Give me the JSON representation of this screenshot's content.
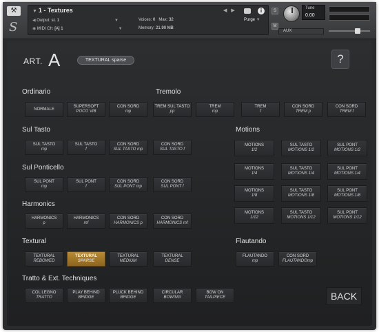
{
  "header": {
    "instrument_title": "1 - Textures",
    "output_label": "Output:",
    "output_value": "st. 1",
    "midi_label": "MIDI Ch:",
    "midi_value": "[A] 1",
    "voices_label": "Voices:",
    "voices_value": "0",
    "max_label": "Max:",
    "max_value": "32",
    "memory_label": "Memory:",
    "memory_value": "21.90 MB",
    "purge_label": "Purge",
    "tune_label": "Tune",
    "tune_value": "0.00",
    "s_button": "S",
    "m_button": "M",
    "aux_label": "AUX",
    "logo": "S"
  },
  "panel": {
    "art_label": "ART.",
    "art_letter": "A",
    "art_preset": "TEXTURAL sparse",
    "help": "?",
    "back": "BACK"
  },
  "sections": {
    "ordinario": "Ordinario",
    "tremolo": "Tremolo",
    "sul_tasto": "Sul Tasto",
    "motions": "Motions",
    "sul_ponticello": "Sul Ponticello",
    "harmonics": "Harmonics",
    "textural": "Textural",
    "flautando": "Flautando",
    "tratto": "Tratto & Ext. Techniques"
  },
  "buttons": {
    "ordinario": [
      [
        "NORMALE",
        ""
      ],
      [
        "SUPERSOFT",
        "POCO VIB"
      ],
      [
        "CON SORD",
        "mp"
      ]
    ],
    "tremolo": [
      [
        "TREM SUL TASTO",
        "pp"
      ],
      [
        "TREM",
        "mp"
      ],
      [
        "TREM",
        "f"
      ],
      [
        "CON SORD",
        "TREM p"
      ],
      [
        "CON SORD",
        "TREM f"
      ]
    ],
    "sul_tasto": [
      [
        "SUL TASTO",
        "mp"
      ],
      [
        "SUL TASTO",
        "f"
      ],
      [
        "CON SORD",
        "SUL TASTO mp"
      ],
      [
        "CON SORD",
        "SUL TASTO f"
      ]
    ],
    "sul_ponticello": [
      [
        "SUL PONT",
        "mp"
      ],
      [
        "SUL PONT",
        "f"
      ],
      [
        "CON SORD",
        "SUL PONT mp"
      ],
      [
        "CON SORD",
        "SUL PONT f"
      ]
    ],
    "harmonics": [
      [
        "HARMONICS",
        "p"
      ],
      [
        "HARMONICS",
        "mf"
      ],
      [
        "CON SORD",
        "HARMONICS p"
      ],
      [
        "CON SORD",
        "HARMONICS mf"
      ]
    ],
    "motions": [
      [
        "MOTIONS",
        "1/2"
      ],
      [
        "SUL TASTO",
        "MOTIONS 1/2"
      ],
      [
        "SUL PONT",
        "MOTIONS 1/2"
      ],
      [
        "MOTIONS",
        "1/4"
      ],
      [
        "SUL TASTO",
        "MOTIONS 1/4"
      ],
      [
        "SUL PONT",
        "MOTIONS 1/4"
      ],
      [
        "MOTIONS",
        "1/8"
      ],
      [
        "SUL TASTO",
        "MOTIONS 1/8"
      ],
      [
        "SUL PONT",
        "MOTIONS 1/8"
      ],
      [
        "MOTIONS",
        "1/12"
      ],
      [
        "SUL TASTO",
        "MOTIONS 1/12"
      ],
      [
        "SUL PONT",
        "MOTIONS 1/12"
      ]
    ],
    "textural": [
      [
        "TEXTURAL",
        "REBOWED"
      ],
      [
        "TEXTURAL",
        "SPARSE"
      ],
      [
        "TEXTURAL",
        "MEDIUM"
      ],
      [
        "TEXTURAL",
        "DENSE"
      ]
    ],
    "flautando": [
      [
        "FLAUTANDO",
        "mp"
      ],
      [
        "CON SORD",
        "FLAUTANDOmp"
      ]
    ],
    "tratto": [
      [
        "COL LEGNO",
        "TRATTO"
      ],
      [
        "PLAY BEHIND",
        "BRIDGE"
      ],
      [
        "PLUCK BEHIND",
        "BRIDGE"
      ],
      [
        "CIRCULAR",
        "BOWING"
      ],
      [
        "BOW ON",
        "TAILPIECE"
      ]
    ]
  },
  "selected_button": "textural.1",
  "colors": {
    "accent": "#b88a34",
    "panel_bg": "#242627",
    "button_bg": "#2f3133"
  },
  "icons": [
    "wrench-icon",
    "camera-icon",
    "info-icon",
    "tune-knob-icon"
  ]
}
